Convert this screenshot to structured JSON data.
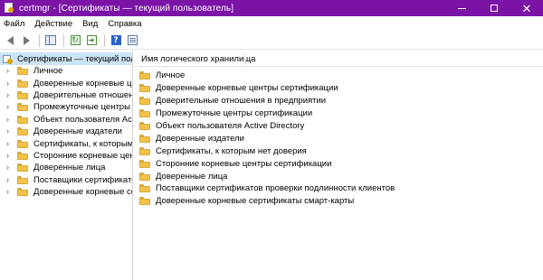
{
  "window": {
    "title": "certmgr - [Сертификаты — текущий пользователь]",
    "accent_color": "#7a13a6"
  },
  "menu": {
    "items": [
      "Файл",
      "Действие",
      "Вид",
      "Справка"
    ]
  },
  "toolbar": {
    "icons": [
      "back-icon",
      "forward-icon",
      "show-tree-icon",
      "refresh-icon",
      "export-list-icon",
      "help-icon",
      "properties-icon"
    ]
  },
  "tree": {
    "root_label": "Сертификаты — текущий пользо",
    "root_selected": true,
    "nodes": [
      "Личное",
      "Доверенные корневые цент",
      "Доверительные отношения",
      "Промежуточные центры се",
      "Объект пользователя Active",
      "Доверенные издатели",
      "Сертификаты, к которым не",
      "Сторонние корневые центр",
      "Доверенные лица",
      "Поставщики сертификатов",
      "Доверенные корневые серт"
    ]
  },
  "list": {
    "column_header": "Имя логического хранилища",
    "items": [
      "Личное",
      "Доверенные корневые центры сертификации",
      "Доверительные отношения в предприятии",
      "Промежуточные центры сертификации",
      "Объект пользователя Active Directory",
      "Доверенные издатели",
      "Сертификаты, к которым нет доверия",
      "Сторонние корневые центры сертификации",
      "Доверенные лица",
      "Поставщики сертификатов проверки подлинности клиентов",
      "Доверенные корневые сертификаты смарт-карты"
    ]
  }
}
